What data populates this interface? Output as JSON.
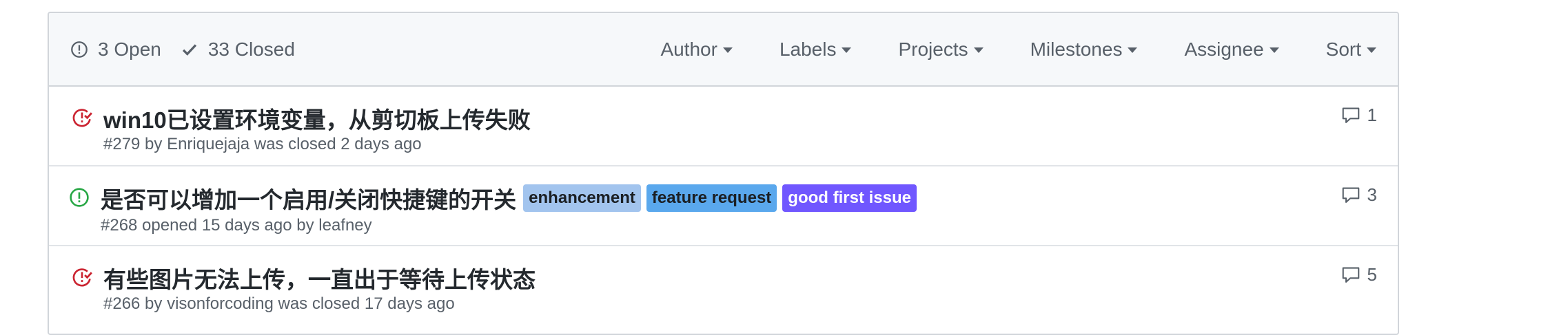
{
  "header": {
    "open_label": "3 Open",
    "closed_label": "33 Closed",
    "filters": [
      "Author",
      "Labels",
      "Projects",
      "Milestones",
      "Assignee",
      "Sort"
    ]
  },
  "issues": [
    {
      "state": "closed",
      "title": "win10已设置环境变量，从剪切板上传失败",
      "meta": "#279 by Enriquejaja was closed 2 days ago",
      "comments": "1",
      "labels": []
    },
    {
      "state": "open",
      "title": "是否可以增加一个启用/关闭快捷键的开关",
      "meta": "#268 opened 15 days ago by leafney",
      "comments": "3",
      "labels": [
        {
          "name": "enhancement",
          "color": "#a2c4ee"
        },
        {
          "name": "feature request",
          "color": "#5aa8ed"
        },
        {
          "name": "good first issue",
          "color": "#7057ff"
        }
      ]
    },
    {
      "state": "closed",
      "title": "有些图片无法上传，一直出于等待上传状态",
      "meta": "#266 by visonforcoding was closed 17 days ago",
      "comments": "5",
      "labels": []
    }
  ],
  "colors": {
    "open_icon": "#28a745",
    "closed_icon": "#cb2431",
    "header_bg": "#f6f8fa",
    "border": "#d1d5da"
  },
  "icons": {
    "open": "issue-opened-icon",
    "closed": "issue-closed-icon",
    "check": "check-icon",
    "comment": "comment-icon",
    "caret": "caret-down-icon"
  }
}
